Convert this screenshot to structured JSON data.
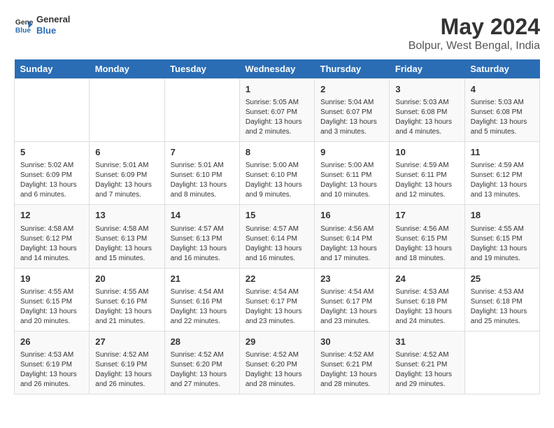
{
  "header": {
    "logo_general": "General",
    "logo_blue": "Blue",
    "title": "May 2024",
    "subtitle": "Bolpur, West Bengal, India"
  },
  "days_of_week": [
    "Sunday",
    "Monday",
    "Tuesday",
    "Wednesday",
    "Thursday",
    "Friday",
    "Saturday"
  ],
  "weeks": [
    [
      {
        "day": "",
        "info": ""
      },
      {
        "day": "",
        "info": ""
      },
      {
        "day": "",
        "info": ""
      },
      {
        "day": "1",
        "info": "Sunrise: 5:05 AM\nSunset: 6:07 PM\nDaylight: 13 hours\nand 2 minutes."
      },
      {
        "day": "2",
        "info": "Sunrise: 5:04 AM\nSunset: 6:07 PM\nDaylight: 13 hours\nand 3 minutes."
      },
      {
        "day": "3",
        "info": "Sunrise: 5:03 AM\nSunset: 6:08 PM\nDaylight: 13 hours\nand 4 minutes."
      },
      {
        "day": "4",
        "info": "Sunrise: 5:03 AM\nSunset: 6:08 PM\nDaylight: 13 hours\nand 5 minutes."
      }
    ],
    [
      {
        "day": "5",
        "info": "Sunrise: 5:02 AM\nSunset: 6:09 PM\nDaylight: 13 hours\nand 6 minutes."
      },
      {
        "day": "6",
        "info": "Sunrise: 5:01 AM\nSunset: 6:09 PM\nDaylight: 13 hours\nand 7 minutes."
      },
      {
        "day": "7",
        "info": "Sunrise: 5:01 AM\nSunset: 6:10 PM\nDaylight: 13 hours\nand 8 minutes."
      },
      {
        "day": "8",
        "info": "Sunrise: 5:00 AM\nSunset: 6:10 PM\nDaylight: 13 hours\nand 9 minutes."
      },
      {
        "day": "9",
        "info": "Sunrise: 5:00 AM\nSunset: 6:11 PM\nDaylight: 13 hours\nand 10 minutes."
      },
      {
        "day": "10",
        "info": "Sunrise: 4:59 AM\nSunset: 6:11 PM\nDaylight: 13 hours\nand 12 minutes."
      },
      {
        "day": "11",
        "info": "Sunrise: 4:59 AM\nSunset: 6:12 PM\nDaylight: 13 hours\nand 13 minutes."
      }
    ],
    [
      {
        "day": "12",
        "info": "Sunrise: 4:58 AM\nSunset: 6:12 PM\nDaylight: 13 hours\nand 14 minutes."
      },
      {
        "day": "13",
        "info": "Sunrise: 4:58 AM\nSunset: 6:13 PM\nDaylight: 13 hours\nand 15 minutes."
      },
      {
        "day": "14",
        "info": "Sunrise: 4:57 AM\nSunset: 6:13 PM\nDaylight: 13 hours\nand 16 minutes."
      },
      {
        "day": "15",
        "info": "Sunrise: 4:57 AM\nSunset: 6:14 PM\nDaylight: 13 hours\nand 16 minutes."
      },
      {
        "day": "16",
        "info": "Sunrise: 4:56 AM\nSunset: 6:14 PM\nDaylight: 13 hours\nand 17 minutes."
      },
      {
        "day": "17",
        "info": "Sunrise: 4:56 AM\nSunset: 6:15 PM\nDaylight: 13 hours\nand 18 minutes."
      },
      {
        "day": "18",
        "info": "Sunrise: 4:55 AM\nSunset: 6:15 PM\nDaylight: 13 hours\nand 19 minutes."
      }
    ],
    [
      {
        "day": "19",
        "info": "Sunrise: 4:55 AM\nSunset: 6:15 PM\nDaylight: 13 hours\nand 20 minutes."
      },
      {
        "day": "20",
        "info": "Sunrise: 4:55 AM\nSunset: 6:16 PM\nDaylight: 13 hours\nand 21 minutes."
      },
      {
        "day": "21",
        "info": "Sunrise: 4:54 AM\nSunset: 6:16 PM\nDaylight: 13 hours\nand 22 minutes."
      },
      {
        "day": "22",
        "info": "Sunrise: 4:54 AM\nSunset: 6:17 PM\nDaylight: 13 hours\nand 23 minutes."
      },
      {
        "day": "23",
        "info": "Sunrise: 4:54 AM\nSunset: 6:17 PM\nDaylight: 13 hours\nand 23 minutes."
      },
      {
        "day": "24",
        "info": "Sunrise: 4:53 AM\nSunset: 6:18 PM\nDaylight: 13 hours\nand 24 minutes."
      },
      {
        "day": "25",
        "info": "Sunrise: 4:53 AM\nSunset: 6:18 PM\nDaylight: 13 hours\nand 25 minutes."
      }
    ],
    [
      {
        "day": "26",
        "info": "Sunrise: 4:53 AM\nSunset: 6:19 PM\nDaylight: 13 hours\nand 26 minutes."
      },
      {
        "day": "27",
        "info": "Sunrise: 4:52 AM\nSunset: 6:19 PM\nDaylight: 13 hours\nand 26 minutes."
      },
      {
        "day": "28",
        "info": "Sunrise: 4:52 AM\nSunset: 6:20 PM\nDaylight: 13 hours\nand 27 minutes."
      },
      {
        "day": "29",
        "info": "Sunrise: 4:52 AM\nSunset: 6:20 PM\nDaylight: 13 hours\nand 28 minutes."
      },
      {
        "day": "30",
        "info": "Sunrise: 4:52 AM\nSunset: 6:21 PM\nDaylight: 13 hours\nand 28 minutes."
      },
      {
        "day": "31",
        "info": "Sunrise: 4:52 AM\nSunset: 6:21 PM\nDaylight: 13 hours\nand 29 minutes."
      },
      {
        "day": "",
        "info": ""
      }
    ]
  ]
}
